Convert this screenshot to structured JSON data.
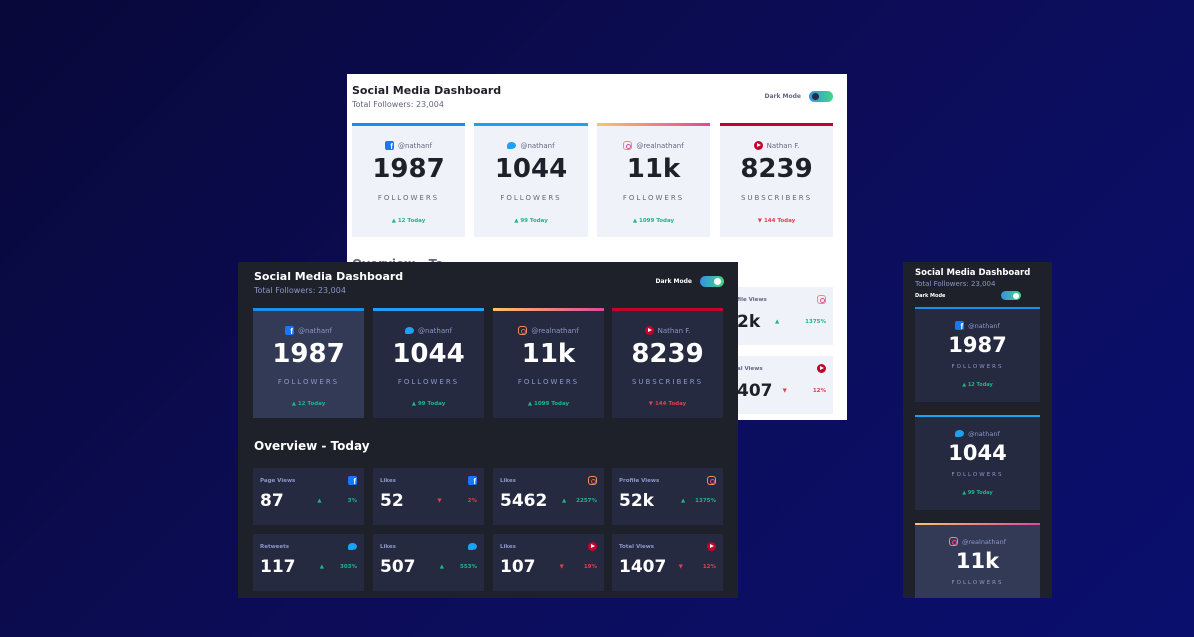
{
  "app": {
    "title": "Social Media Dashboard",
    "total_followers": "Total Followers: 23,004",
    "dark_mode_label": "Dark Mode"
  },
  "colors": {
    "facebook": "#1877f2",
    "twitter": "#1da1f2",
    "instagram_start": "#fdc468",
    "instagram_end": "#df4996",
    "youtube": "#c4032b",
    "up": "#1eb589",
    "down": "#dc414c"
  },
  "cards": [
    {
      "icon": "facebook-icon",
      "handle": "@nathanf",
      "count": "1987",
      "label": "FOLLOWERS",
      "change": "12 Today",
      "trend": "up"
    },
    {
      "icon": "twitter-icon",
      "handle": "@nathanf",
      "count": "1044",
      "label": "FOLLOWERS",
      "change": "99 Today",
      "trend": "up"
    },
    {
      "icon": "instagram-icon",
      "handle": "@realnathanf",
      "count": "11k",
      "label": "FOLLOWERS",
      "change": "1099 Today",
      "trend": "up"
    },
    {
      "icon": "youtube-icon",
      "handle": "Nathan F.",
      "count": "8239",
      "label": "SUBSCRIBERS",
      "change": "144 Today",
      "trend": "down"
    }
  ],
  "overview": {
    "title": "Overview - Today",
    "title_partial": "Overview - To",
    "items": [
      {
        "label": "Page Views",
        "icon": "facebook-icon",
        "value": "87",
        "pct": "3%",
        "trend": "up"
      },
      {
        "label": "Likes",
        "icon": "facebook-icon",
        "value": "52",
        "pct": "2%",
        "trend": "down"
      },
      {
        "label": "Likes",
        "icon": "instagram-icon",
        "value": "5462",
        "pct": "2257%",
        "trend": "up"
      },
      {
        "label": "Profile Views",
        "icon": "instagram-icon",
        "value": "52k",
        "pct": "1375%",
        "trend": "up"
      },
      {
        "label": "Retweets",
        "icon": "twitter-icon",
        "value": "117",
        "pct": "303%",
        "trend": "up"
      },
      {
        "label": "Likes",
        "icon": "twitter-icon",
        "value": "507",
        "pct": "553%",
        "trend": "up"
      },
      {
        "label": "Likes",
        "icon": "youtube-icon",
        "value": "107",
        "pct": "19%",
        "trend": "down"
      },
      {
        "label": "Total Views",
        "icon": "youtube-icon",
        "value": "1407",
        "pct": "12%",
        "trend": "down"
      }
    ],
    "partial_light": [
      {
        "label": "file Views",
        "value": "2k",
        "pct": "1375%"
      },
      {
        "label": "al Views",
        "value": "407",
        "pct": "12%"
      }
    ]
  }
}
